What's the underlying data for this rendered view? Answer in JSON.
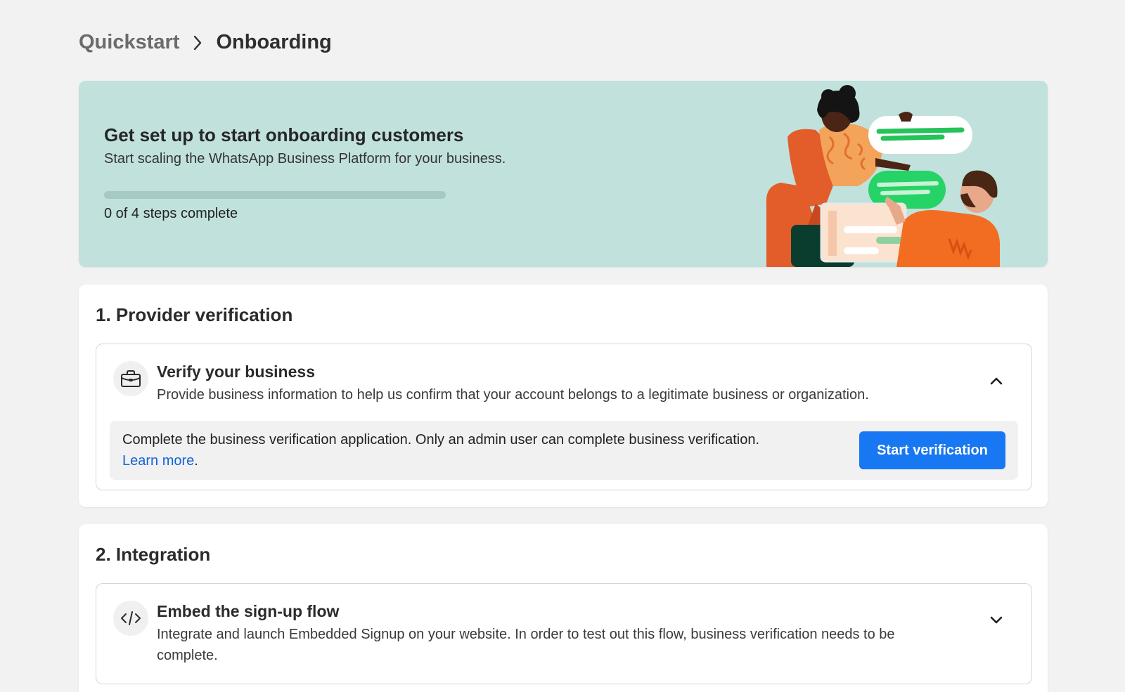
{
  "breadcrumb": {
    "parent": "Quickstart",
    "current": "Onboarding"
  },
  "hero": {
    "title": "Get set up to start onboarding customers",
    "subtitle": "Start scaling the WhatsApp Business Platform for your business.",
    "progress_text": "0 of 4 steps complete",
    "progress_fraction": 0,
    "background_color": "#c1e1dd"
  },
  "sections": [
    {
      "title": "1. Provider verification",
      "step": {
        "icon": "briefcase-icon",
        "title": "Verify your business",
        "description": "Provide business information to help us confirm that your account belongs to a legitimate business or organization.",
        "expanded": true,
        "chevron": "chevron-up-icon",
        "action_text": "Complete the business verification application. Only an admin user can complete business verification.",
        "learn_more": "Learn more",
        "learn_more_suffix": ".",
        "button_label": "Start verification"
      }
    },
    {
      "title": "2. Integration",
      "step": {
        "icon": "code-icon",
        "title": "Embed the sign-up flow",
        "description": "Integrate and launch Embedded Signup on your website. In order to test out this flow, business verification needs to be complete.",
        "expanded": false,
        "chevron": "chevron-down-icon"
      }
    }
  ],
  "colors": {
    "primary_button": "#1877f2",
    "link": "#1463d6",
    "page_background": "#f2f2f2"
  }
}
